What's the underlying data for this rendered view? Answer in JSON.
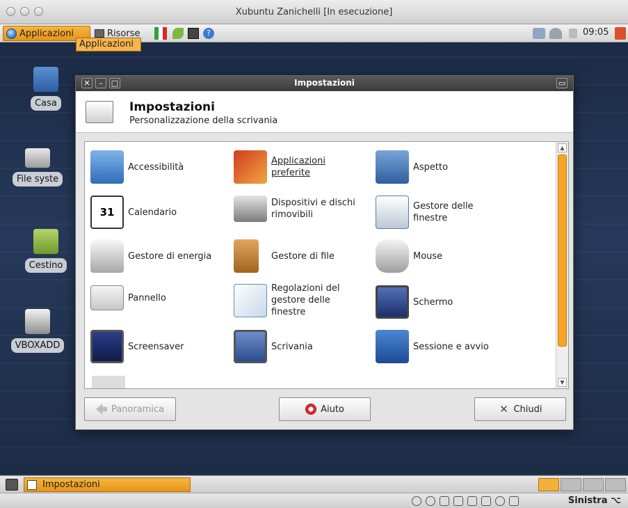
{
  "host": {
    "title": "Xubuntu Zanichelli [In esecuzione]"
  },
  "top_panel": {
    "apps_label": "Applicazioni",
    "places_label": "Risorse",
    "clock": "09:05",
    "tooltip": "Applicazioni"
  },
  "desktop": {
    "icons": [
      {
        "label": "Casa"
      },
      {
        "label": "File syste"
      },
      {
        "label": "Cestino"
      },
      {
        "label": "VBOXADD"
      }
    ]
  },
  "dialog": {
    "title": "Impostazioni",
    "header_title": "Impostazioni",
    "header_subtitle": "Personalizzazione della scrivania",
    "items": [
      {
        "label": "Accessibilità",
        "icon": "accessibility-icon"
      },
      {
        "label": "Applicazioni preferite",
        "icon": "preferred-apps-icon"
      },
      {
        "label": "Aspetto",
        "icon": "appearance-icon"
      },
      {
        "label": "Calendario",
        "icon": "calendar-icon",
        "day": "31"
      },
      {
        "label": "Dispositivi e dischi rimovibili",
        "icon": "removable-drives-icon"
      },
      {
        "label": "Gestore delle finestre",
        "icon": "window-manager-icon"
      },
      {
        "label": "Gestore di energia",
        "icon": "power-manager-icon"
      },
      {
        "label": "Gestore di file",
        "icon": "file-manager-icon"
      },
      {
        "label": "Mouse",
        "icon": "mouse-icon"
      },
      {
        "label": "Pannello",
        "icon": "panel-icon"
      },
      {
        "label": "Regolazioni del gestore delle finestre",
        "icon": "window-tweaks-icon"
      },
      {
        "label": "Schermo",
        "icon": "display-icon"
      },
      {
        "label": "Screensaver",
        "icon": "screensaver-icon"
      },
      {
        "label": "Scrivania",
        "icon": "desktop-settings-icon"
      },
      {
        "label": "Sessione e avvio",
        "icon": "session-icon"
      }
    ],
    "buttons": {
      "overview": "Panoramica",
      "help": "Aiuto",
      "close": "Chiudi"
    }
  },
  "bottom_panel": {
    "task_label": "Impostazioni"
  },
  "host_status": {
    "keyboard_label": "Sinistra ⌥"
  }
}
